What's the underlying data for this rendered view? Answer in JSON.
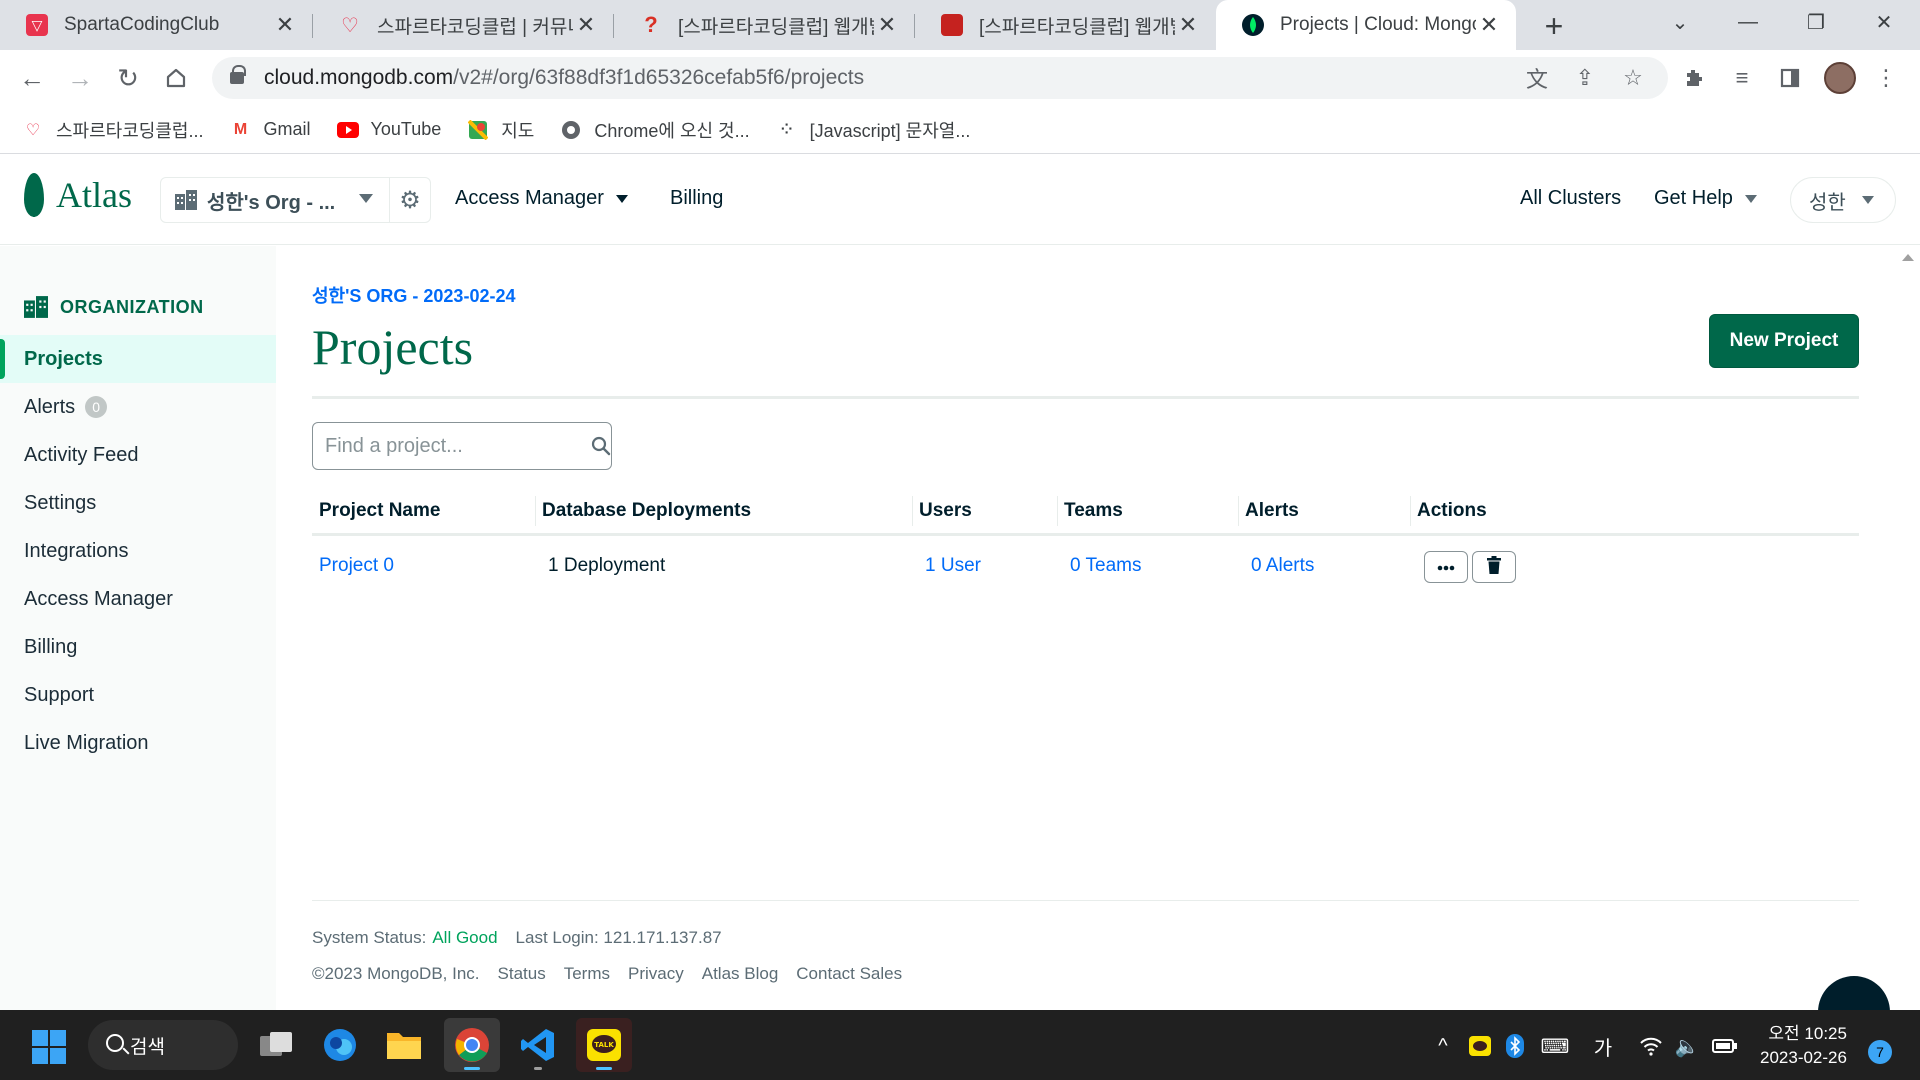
{
  "browser": {
    "tabs": [
      {
        "title": "SpartaCodingClub",
        "icon": "sparta-favicon",
        "color": "#e8344e"
      },
      {
        "title": "스파르타코딩클럽 | 커뮤니",
        "icon": "sparta-heart-favicon",
        "color": "#e8344e"
      },
      {
        "title": "[스파르타코딩클럽] 웹개발",
        "icon": "question-favicon",
        "color": "#d93025"
      },
      {
        "title": "[스파르타코딩클럽] 웹개발",
        "icon": "book-favicon",
        "color": "#c5221f"
      },
      {
        "title": "Projects | Cloud: MongoDB",
        "icon": "mongodb-leaf-favicon",
        "color": "#00684a",
        "active": true
      }
    ],
    "url_host": "cloud.mongodb.com",
    "url_path": "/v2#/org/63f88df3f1d65326cefab5f6/projects",
    "bookmarks": [
      {
        "label": "스파르타코딩클럽...",
        "icon": "sparta-heart-icon"
      },
      {
        "label": "Gmail",
        "icon": "gmail-icon"
      },
      {
        "label": "YouTube",
        "icon": "youtube-icon"
      },
      {
        "label": "지도",
        "icon": "maps-icon"
      },
      {
        "label": "Chrome에 오신 것...",
        "icon": "chrome-icon"
      },
      {
        "label": "[Javascript] 문자열...",
        "icon": "dots-icon"
      }
    ]
  },
  "header": {
    "logo_text": "Atlas",
    "org_name": "성한's Org - ...",
    "nav": {
      "access_manager": "Access Manager",
      "billing": "Billing",
      "all_clusters": "All Clusters",
      "get_help": "Get Help"
    },
    "user_name": "성한"
  },
  "sidebar": {
    "section_title": "ORGANIZATION",
    "items": [
      {
        "label": "Projects",
        "active": true
      },
      {
        "label": "Alerts",
        "badge": "0"
      },
      {
        "label": "Activity Feed"
      },
      {
        "label": "Settings"
      },
      {
        "label": "Integrations"
      },
      {
        "label": "Access Manager"
      },
      {
        "label": "Billing"
      },
      {
        "label": "Support"
      },
      {
        "label": "Live Migration"
      }
    ]
  },
  "main": {
    "breadcrumb": "성한'S ORG - 2023-02-24",
    "title": "Projects",
    "new_project_label": "New Project",
    "search_placeholder": "Find a project...",
    "columns": [
      "Project Name",
      "Database Deployments",
      "Users",
      "Teams",
      "Alerts",
      "Actions"
    ],
    "rows": [
      {
        "project_name": "Project 0",
        "deployments": "1 Deployment",
        "users": "1 User",
        "teams": "0 Teams",
        "alerts": "0 Alerts"
      }
    ],
    "footer": {
      "system_status_label": "System Status:",
      "system_status_value": "All Good",
      "last_login": "Last Login: 121.171.137.87",
      "copyright": "©2023 MongoDB, Inc.",
      "links": [
        "Status",
        "Terms",
        "Privacy",
        "Atlas Blog",
        "Contact Sales"
      ]
    }
  },
  "taskbar": {
    "search_label": "검색",
    "ime_label": "가",
    "time": "오전 10:25",
    "date": "2023-02-26",
    "notification_count": "7"
  },
  "colors": {
    "brand_green": "#00684a",
    "link_blue": "#016bf8",
    "status_green": "#00a35c"
  }
}
